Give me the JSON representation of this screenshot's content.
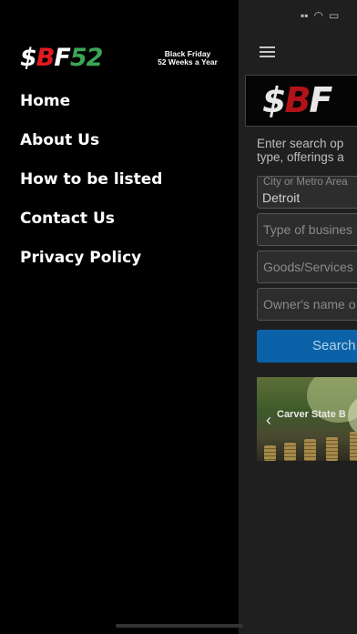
{
  "drawer": {
    "logo": {
      "dollar": "$",
      "b": "B",
      "f": "F",
      "num": "52",
      "tagline_1": "Black Friday",
      "tagline_2": "52 Weeks a Year"
    },
    "menu": [
      {
        "label": "Home"
      },
      {
        "label": "About Us"
      },
      {
        "label": "How to be listed"
      },
      {
        "label": "Contact Us"
      },
      {
        "label": "Privacy Policy"
      }
    ]
  },
  "main": {
    "banner": {
      "dollar": "$",
      "b": "B",
      "f": "F"
    },
    "intro_line_1": "Enter search op",
    "intro_line_2": "type, offerings a",
    "city_field": {
      "label": "City or Metro Area",
      "value": "Detroit"
    },
    "business_type_field": {
      "placeholder": "Type of busines"
    },
    "goods_field": {
      "placeholder": "Goods/Services"
    },
    "owner_field": {
      "placeholder": "Owner's name o"
    },
    "search_label": "Search",
    "carousel": {
      "title": "Carver State B",
      "prev_icon": "chevron-left-icon"
    }
  },
  "colors": {
    "brand_red": "#e11b22",
    "brand_green": "#3aa655",
    "search_blue": "#0b62a8"
  }
}
